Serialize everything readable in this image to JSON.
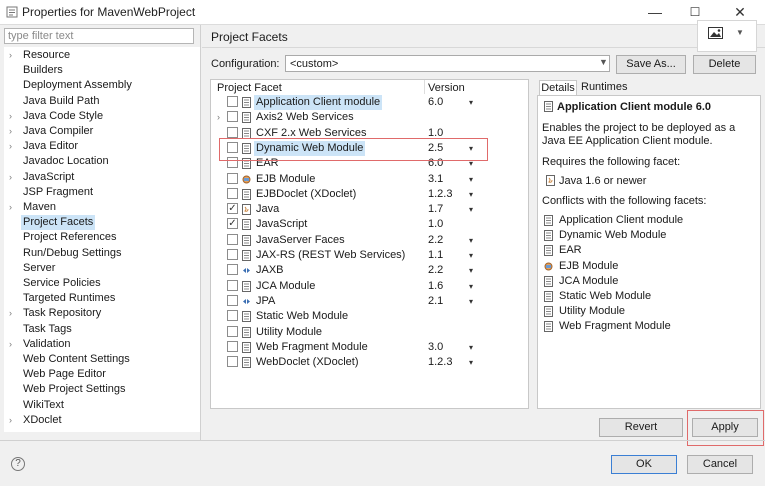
{
  "window": {
    "title": "Properties for MavenWebProject",
    "min": "—",
    "max": "☐",
    "close": "✕"
  },
  "filter": {
    "placeholder": "type filter text"
  },
  "tree": [
    {
      "label": "Resource",
      "arrow": true
    },
    {
      "label": "Builders",
      "arrow": false
    },
    {
      "label": "Deployment Assembly",
      "arrow": false
    },
    {
      "label": "Java Build Path",
      "arrow": false
    },
    {
      "label": "Java Code Style",
      "arrow": true
    },
    {
      "label": "Java Compiler",
      "arrow": true
    },
    {
      "label": "Java Editor",
      "arrow": true
    },
    {
      "label": "Javadoc Location",
      "arrow": false
    },
    {
      "label": "JavaScript",
      "arrow": true
    },
    {
      "label": "JSP Fragment",
      "arrow": false
    },
    {
      "label": "Maven",
      "arrow": true
    },
    {
      "label": "Project Facets",
      "arrow": false,
      "selected": true
    },
    {
      "label": "Project References",
      "arrow": false
    },
    {
      "label": "Run/Debug Settings",
      "arrow": false
    },
    {
      "label": "Server",
      "arrow": false
    },
    {
      "label": "Service Policies",
      "arrow": false
    },
    {
      "label": "Targeted Runtimes",
      "arrow": false
    },
    {
      "label": "Task Repository",
      "arrow": true
    },
    {
      "label": "Task Tags",
      "arrow": false
    },
    {
      "label": "Validation",
      "arrow": true
    },
    {
      "label": "Web Content Settings",
      "arrow": false
    },
    {
      "label": "Web Page Editor",
      "arrow": false
    },
    {
      "label": "Web Project Settings",
      "arrow": false
    },
    {
      "label": "WikiText",
      "arrow": false
    },
    {
      "label": "XDoclet",
      "arrow": true
    }
  ],
  "header": {
    "title": "Project Facets"
  },
  "config": {
    "label": "Configuration:",
    "value": "<custom>",
    "save_as": "Save As...",
    "delete": "Delete"
  },
  "table": {
    "col_facet": "Project Facet",
    "col_version": "Version",
    "rows": [
      {
        "name": "Application Client module",
        "version": "6.0",
        "dd": true,
        "checked": false,
        "selected": true,
        "icon": "page"
      },
      {
        "name": "Axis2 Web Services",
        "version": "",
        "dd": false,
        "checked": false,
        "expand": true,
        "icon": "page"
      },
      {
        "name": "CXF 2.x Web Services",
        "version": "1.0",
        "dd": false,
        "checked": false,
        "icon": "page"
      },
      {
        "name": "Dynamic Web Module",
        "version": "2.5",
        "dd": true,
        "checked": false,
        "selected": true,
        "icon": "page"
      },
      {
        "name": "EAR",
        "version": "6.0",
        "dd": true,
        "checked": false,
        "icon": "page"
      },
      {
        "name": "EJB Module",
        "version": "3.1",
        "dd": true,
        "checked": false,
        "icon": "ejb"
      },
      {
        "name": "EJBDoclet (XDoclet)",
        "version": "1.2.3",
        "dd": true,
        "checked": false,
        "icon": "page"
      },
      {
        "name": "Java",
        "version": "1.7",
        "dd": true,
        "checked": true,
        "icon": "java"
      },
      {
        "name": "JavaScript",
        "version": "1.0",
        "dd": false,
        "checked": true,
        "icon": "page"
      },
      {
        "name": "JavaServer Faces",
        "version": "2.2",
        "dd": true,
        "checked": false,
        "icon": "page"
      },
      {
        "name": "JAX-RS (REST Web Services)",
        "version": "1.1",
        "dd": true,
        "checked": false,
        "icon": "page"
      },
      {
        "name": "JAXB",
        "version": "2.2",
        "dd": true,
        "checked": false,
        "icon": "jaxb"
      },
      {
        "name": "JCA Module",
        "version": "1.6",
        "dd": true,
        "checked": false,
        "icon": "page"
      },
      {
        "name": "JPA",
        "version": "2.1",
        "dd": true,
        "checked": false,
        "icon": "jaxb"
      },
      {
        "name": "Static Web Module",
        "version": "",
        "dd": false,
        "checked": false,
        "icon": "page"
      },
      {
        "name": "Utility Module",
        "version": "",
        "dd": false,
        "checked": false,
        "icon": "page"
      },
      {
        "name": "Web Fragment Module",
        "version": "3.0",
        "dd": true,
        "checked": false,
        "icon": "page"
      },
      {
        "name": "WebDoclet (XDoclet)",
        "version": "1.2.3",
        "dd": true,
        "checked": false,
        "icon": "page"
      }
    ]
  },
  "details": {
    "tab_details": "Details",
    "tab_runtimes": "Runtimes",
    "title": "Application Client module 6.0",
    "description": "Enables the project to be deployed as a Java EE Application Client module.",
    "requires_label": "Requires the following facet:",
    "requires_item": "Java 1.6 or newer",
    "conflicts_label": "Conflicts with the following facets:",
    "conflicts": [
      {
        "label": "Application Client module",
        "icon": "page"
      },
      {
        "label": "Dynamic Web Module",
        "icon": "page"
      },
      {
        "label": "EAR",
        "icon": "page"
      },
      {
        "label": "EJB Module",
        "icon": "ejb"
      },
      {
        "label": "JCA Module",
        "icon": "page"
      },
      {
        "label": "Static Web Module",
        "icon": "page"
      },
      {
        "label": "Utility Module",
        "icon": "page"
      },
      {
        "label": "Web Fragment Module",
        "icon": "page"
      }
    ]
  },
  "buttons": {
    "revert": "Revert",
    "apply": "Apply",
    "ok": "OK",
    "cancel": "Cancel",
    "help": "?"
  },
  "colors": {
    "selection": "#cce4f7",
    "highlight_box": "#e06a6a",
    "ok_border": "#3b7fd4"
  }
}
